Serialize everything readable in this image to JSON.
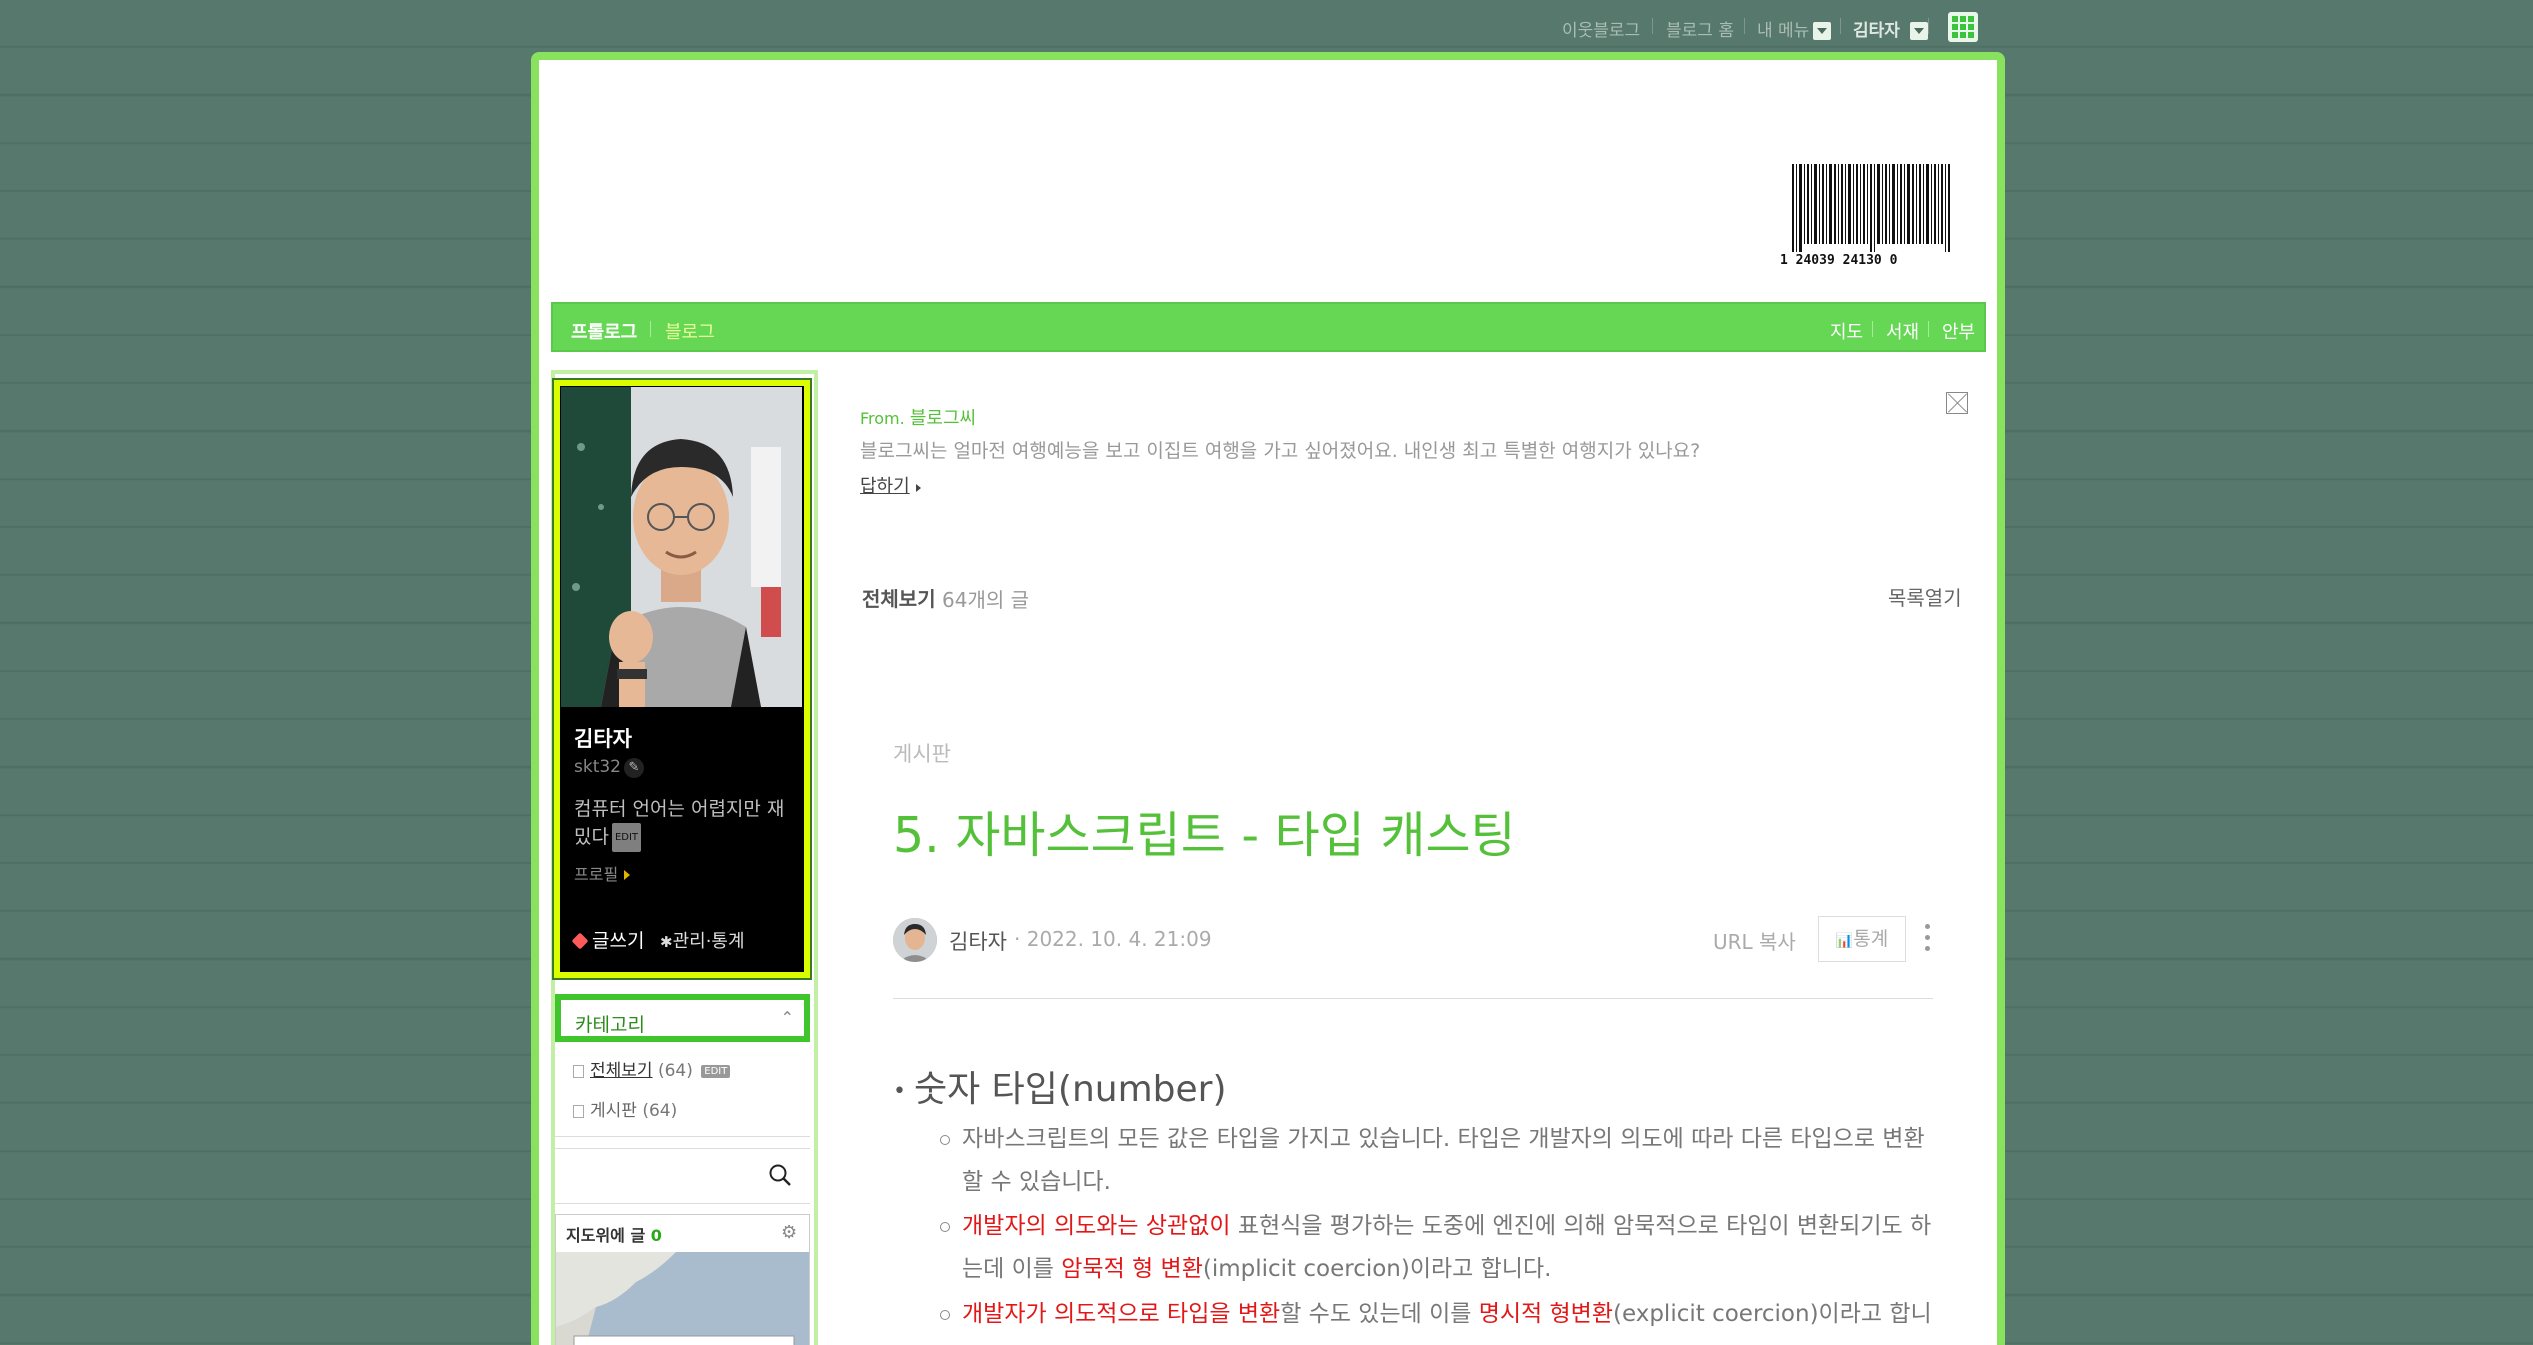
{
  "gnb": {
    "neighbor_blog": "이웃블로그",
    "blog_home": "블로그 홈",
    "my_menu": "내 메뉴",
    "user": "김타자"
  },
  "header": {
    "barcode_text": "1  24039  24130   0"
  },
  "menubar": {
    "prologue": "프롤로그",
    "blog": "블로그",
    "map": "지도",
    "library": "서재",
    "guestbook": "안부"
  },
  "profile": {
    "name": "김타자",
    "id": "skt32",
    "description": "컴퓨터 언어는 어렵지만 재밌다",
    "edit_badge": "EDIT",
    "profile_link": "프로필",
    "write": "글쓰기",
    "admin": "관리·통계"
  },
  "category": {
    "title": "카테고리",
    "items": [
      {
        "label": "전체보기",
        "count": "(64)",
        "badge": "EDIT"
      },
      {
        "label": "게시판",
        "count": "(64)"
      }
    ]
  },
  "map_widget": {
    "title": "지도위에 글",
    "count": "0"
  },
  "message": {
    "from_label": "From.",
    "from_name": "블로그씨",
    "text": "블로그씨는 얼마전 여행예능을 보고 이집트 여행을 가고 싶어졌어요. 내인생 최고 특별한 여행지가 있나요?",
    "reply": "답하기"
  },
  "listing": {
    "all_label": "전체보기",
    "count_text": "64개의 글",
    "toc_open": "목록열기"
  },
  "post": {
    "category": "게시판",
    "title": "5. 자바스크립트 - 타입 캐스팅",
    "author": "김타자",
    "date": "· 2022. 10. 4. 21:09",
    "url_copy": "URL 복사",
    "stats": "통계",
    "section_heading": "숫자 타입(number)",
    "bullets": [
      {
        "text": "자바스크립트의 모든 값은 타입을 가지고 있습니다. 타입은 개발자의 의도에 따라 다른 타입으로 변환할 수 있습니다."
      },
      {
        "red1": "개발자의 의도와는 상관없이",
        "mid1": " 표현식을 평가하는 도중에 엔진에 의해 암묵적으로 타입이 변환되기도 하는데 이를 ",
        "red2": "암묵적 형 변환",
        "end": "(implicit coercion)이라고 합니다."
      },
      {
        "red1": "개발자가 의도적으로 타입을 변환",
        "mid1": "할 수도 있는데 이를 ",
        "red2": "명시적 형변환",
        "end": "(explicit coercion)이라고 합니"
      }
    ]
  }
}
